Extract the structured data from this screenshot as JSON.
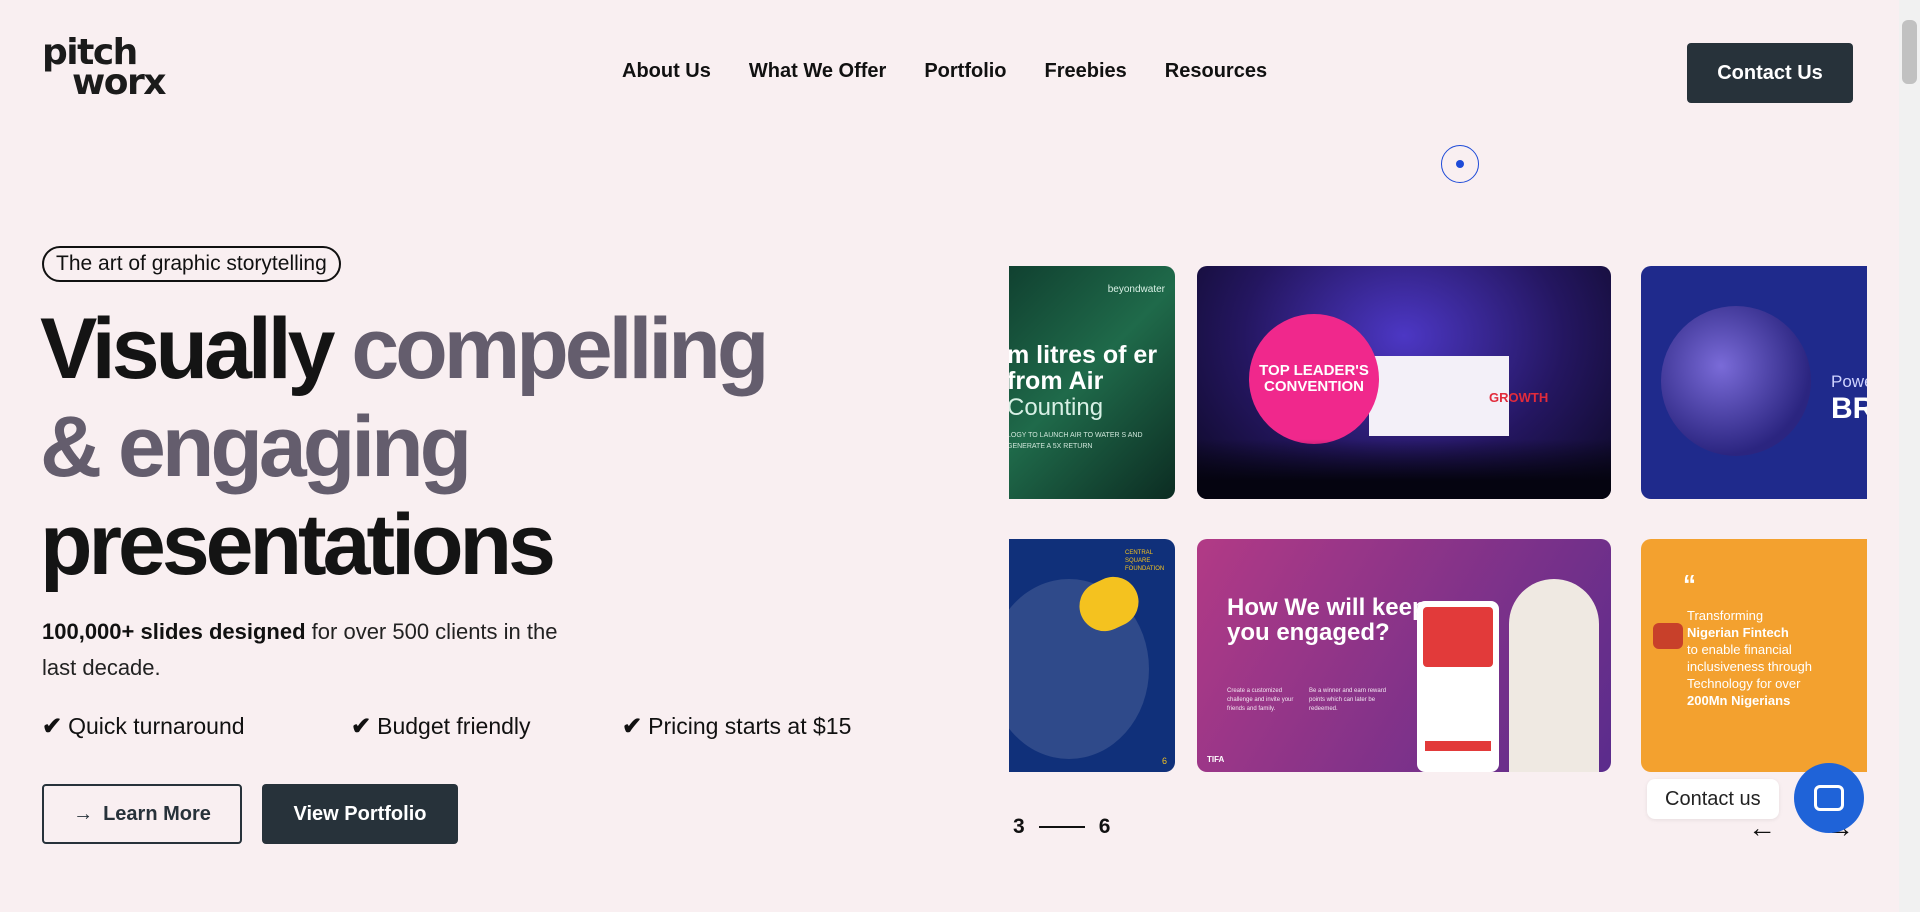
{
  "logo": {
    "line1": "pitch",
    "line2": "worx"
  },
  "nav": {
    "items": [
      {
        "label": "About Us"
      },
      {
        "label": "What We Offer"
      },
      {
        "label": "Portfolio"
      },
      {
        "label": "Freebies"
      },
      {
        "label": "Resources"
      }
    ],
    "contact_label": "Contact Us"
  },
  "hero": {
    "tagline": "The art of graphic storytelling",
    "headline": {
      "line1_dark": "Visually",
      "line1_muted": "compelling",
      "line2_muted": "& engaging",
      "line3_dark": "presentations"
    },
    "stats_bold": "100,000+ slides designed",
    "stats_rest": "for over 500 clients in the last decade.",
    "features": [
      {
        "label": "Quick turnaround"
      },
      {
        "label": "Budget friendly"
      },
      {
        "label": "Pricing starts at $15"
      }
    ],
    "buttons": {
      "learn_more": "Learn More",
      "view_portfolio": "View Portfolio"
    }
  },
  "gallery": {
    "cards": {
      "c1": {
        "brand": "beyondwater",
        "title": "m litres of er from Air",
        "subtitle": "Counting",
        "body": "LOGY TO LAUNCH AIR TO WATER S AND GENERATE A 5X RETURN"
      },
      "c2": {
        "circle_text": "TOP LEADER'S CONVENTION",
        "growth": "GROWTH"
      },
      "c3": {
        "text1": "Powe",
        "text2": "BR"
      },
      "c4": {
        "label": "CENTRAL SQUARE FOUNDATION",
        "page": "6"
      },
      "c5": {
        "headline": "How We will keep you engaged?",
        "para1": "Create a customized challenge and invite your friends and family.",
        "para2": "Be a winner and earn reward points which can later be redeemed.",
        "footer": "TIFA"
      },
      "c6": {
        "quote": "“",
        "text_pre": "Transforming",
        "text_bold1": "Nigerian Fintech",
        "text_mid": "to enable financial inclusiveness through Technology for over",
        "text_bold2": "200Mn Nigerians"
      }
    },
    "counter": {
      "current": "3",
      "total": "6"
    },
    "arrow_left": "←",
    "arrow_right": "→"
  },
  "chat": {
    "label": "Contact us"
  },
  "colors": {
    "background": "#f9eff1",
    "primary_dark": "#27323a",
    "muted_heading": "#645d6d",
    "accent_blue": "#1f63d8"
  }
}
